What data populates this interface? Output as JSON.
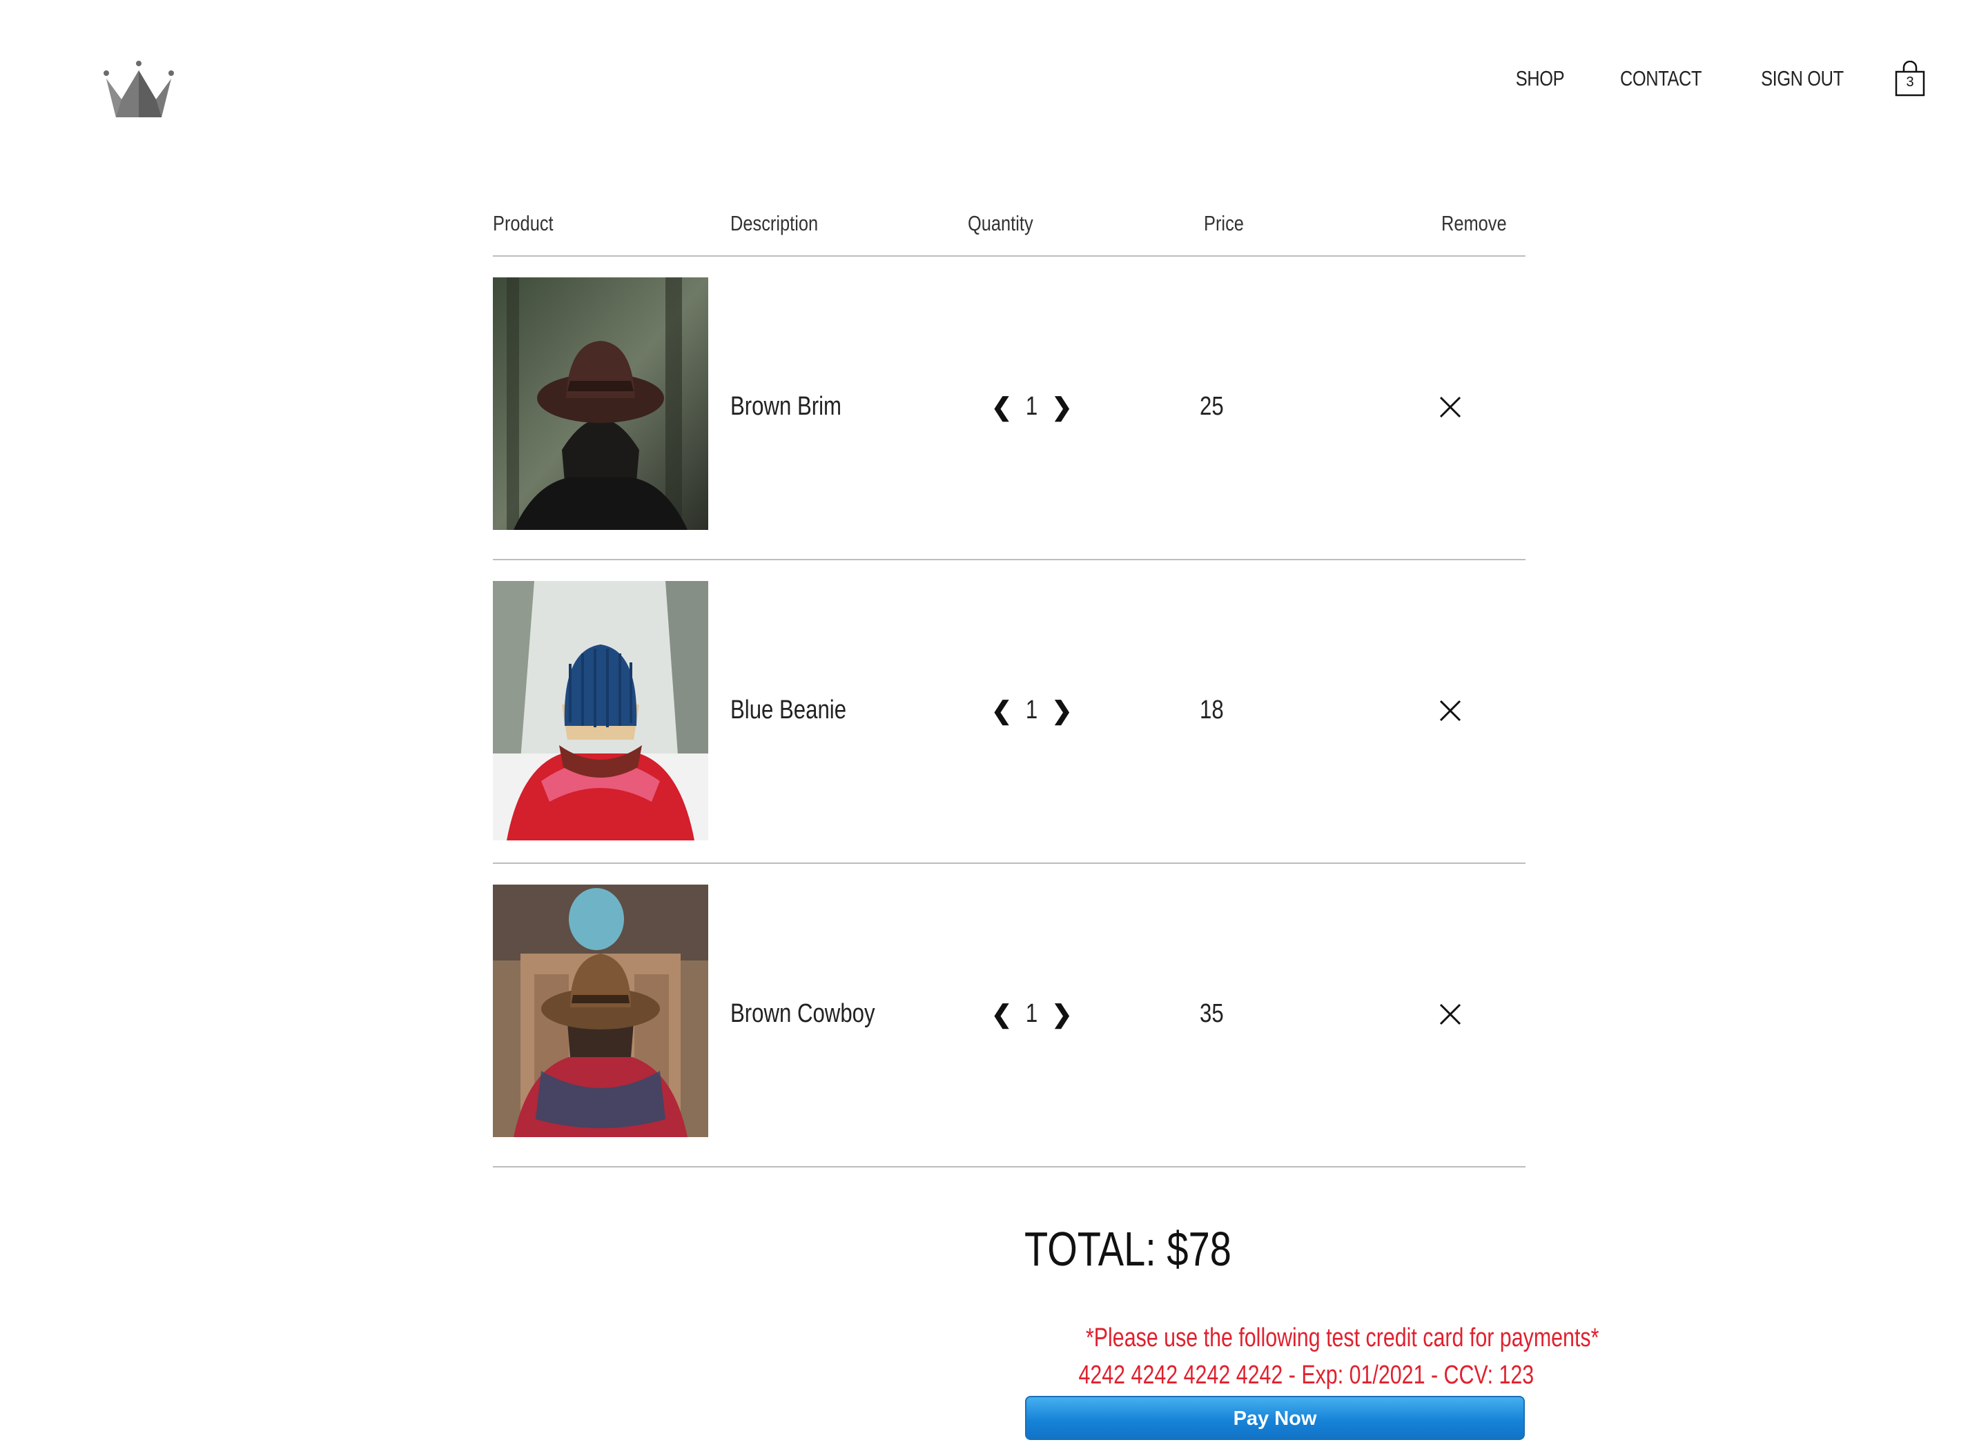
{
  "nav": {
    "links": [
      "SHOP",
      "CONTACT",
      "SIGN OUT"
    ],
    "cart_count": "3"
  },
  "table": {
    "headers": [
      "Product",
      "Description",
      "Quantity",
      "Price",
      "Remove"
    ],
    "rows": [
      {
        "description": "Brown Brim",
        "quantity": "1",
        "price": "25",
        "image": "brown-brim-hat-photo"
      },
      {
        "description": "Blue Beanie",
        "quantity": "1",
        "price": "18",
        "image": "blue-beanie-photo"
      },
      {
        "description": "Brown Cowboy",
        "quantity": "1",
        "price": "35",
        "image": "brown-cowboy-hat-photo"
      }
    ]
  },
  "checkout": {
    "total": "TOTAL: $78",
    "notice_line1": "*Please use the following test credit card for payments*",
    "notice_line2": "4242 4242 4242 4242 - Exp: 01/2021 - CCV: 123",
    "pay_label": "Pay Now"
  },
  "colors": {
    "notice": "#e0212e",
    "pay_button": "#1784d8",
    "divider": "#bdbdbd",
    "logo": "#6b6b6b"
  }
}
